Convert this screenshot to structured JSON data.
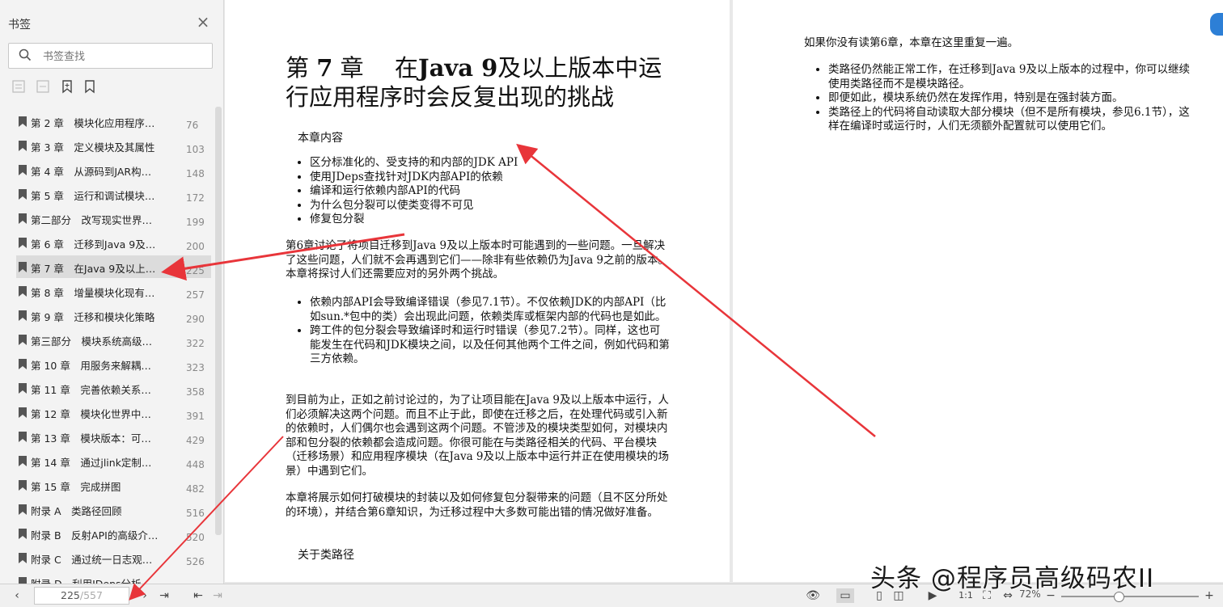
{
  "sidebar": {
    "title": "书签",
    "search_placeholder": "书签查找",
    "items": [
      {
        "label": "第 2 章　模块化应用程序…",
        "page": "76",
        "active": false
      },
      {
        "label": "第 3 章　定义模块及其属性",
        "page": "103",
        "active": false
      },
      {
        "label": "第 4 章　从源码到JAR构…",
        "page": "148",
        "active": false
      },
      {
        "label": "第 5 章　运行和调试模块…",
        "page": "172",
        "active": false
      },
      {
        "label": "第二部分　改写现实世界…",
        "page": "199",
        "active": false
      },
      {
        "label": "第 6 章　迁移到Java 9及…",
        "page": "200",
        "active": false
      },
      {
        "label": "第 7 章　在Java 9及以上…",
        "page": "225",
        "active": true
      },
      {
        "label": "第 8 章　增量模块化现有…",
        "page": "257",
        "active": false
      },
      {
        "label": "第 9 章　迁移和模块化策略",
        "page": "290",
        "active": false
      },
      {
        "label": "第三部分　模块系统高级…",
        "page": "322",
        "active": false
      },
      {
        "label": "第 10 章　用服务来解耦…",
        "page": "323",
        "active": false
      },
      {
        "label": "第 11 章　完善依赖关系…",
        "page": "358",
        "active": false
      },
      {
        "label": "第 12 章　模块化世界中…",
        "page": "391",
        "active": false
      },
      {
        "label": "第 13 章　模块版本：可…",
        "page": "429",
        "active": false
      },
      {
        "label": "第 14 章　通过jlink定制…",
        "page": "448",
        "active": false
      },
      {
        "label": "第 15 章　完成拼图",
        "page": "482",
        "active": false
      },
      {
        "label": "附录 A　类路径回顾",
        "page": "516",
        "active": false
      },
      {
        "label": "附录 B　反射API的高级介…",
        "page": "520",
        "active": false
      },
      {
        "label": "附录 C　通过统一日志观…",
        "page": "526",
        "active": false
      },
      {
        "label": "附录 D　利用JDeps分析…",
        "page": "",
        "active": false
      }
    ]
  },
  "left_page": {
    "title_pre": "第",
    "title_num": "7",
    "title_zhang": "章　 在",
    "title_java": "Java 9",
    "title_rest1": "及以上版本中运",
    "title_line2": "行应用程序时会反复出现的挑战",
    "section1": "本章内容",
    "bullets1": [
      "区分标准化的、受支持的和内部的JDK API",
      "使用JDeps查找针对JDK内部API的依赖",
      "编译和运行依赖内部API的代码",
      "为什么包分裂可以使类变得不可见",
      "修复包分裂"
    ],
    "para1": "第6章讨论了将项目迁移到Java 9及以上版本时可能遇到的一些问题。一旦解决了这些问题，人们就不会再遇到它们——除非有些依赖仍为Java 9之前的版本。本章将探讨人们还需要应对的另外两个挑战。",
    "bullet2a": "依赖内部API会导致编译错误（参见7.1节）。不仅依赖JDK的内部API（比如sun.*包中的类）会出现此问题，依赖类库或框架内部的代码也是如此。",
    "bullet2b": "跨工件的包分裂会导致编译时和运行时错误（参见7.2节）。同样，这也可能发生在代码和JDK模块之间，以及任何其他两个工件之间，例如代码和第三方依赖。",
    "para2": "到目前为止，正如之前讨论过的，为了让项目能在Java 9及以上版本中运行，人们必须解决这两个问题。而且不止于此，即使在迁移之后，在处理代码或引入新的依赖时，人们偶尔也会遇到这两个问题。不管涉及的模块类型如何，对模块内部和包分裂的依赖都会造成问题。你很可能在与类路径相关的代码、平台模块（迁移场景）和应用程序模块（在Java 9及以上版本中运行并正在使用模块的场景）中遇到它们。",
    "para3": "本章将展示如何打破模块的封装以及如何修复包分裂带来的问题（且不区分所处的环境），并结合第6章知识，为迁移过程中大多数可能出错的情况做好准备。",
    "section2": "关于类路径"
  },
  "right_page": {
    "intro": "如果你没有读第6章，本章在这里重复一遍。",
    "bullets": [
      "类路径仍然能正常工作，在迁移到Java 9及以上版本的过程中，你可以继续使用类路径而不是模块路径。",
      "即便如此，模块系统仍然在发挥作用，特别是在强封装方面。",
      "类路径上的代码将自动读取大部分模块（但不是所有模块，参见6.1节），这样在编译时或运行时，人们无须额外配置就可以使用它们。"
    ]
  },
  "bottom": {
    "current_page": "225",
    "total_pages": "/557",
    "zoom": "72%",
    "zoom_level": 0.42
  },
  "watermark": "头条 @程序员高级码农II",
  "colors": {
    "arrow": "#e8353a",
    "accent": "#2d7fd6",
    "active_bg": "#dcdcdc"
  }
}
